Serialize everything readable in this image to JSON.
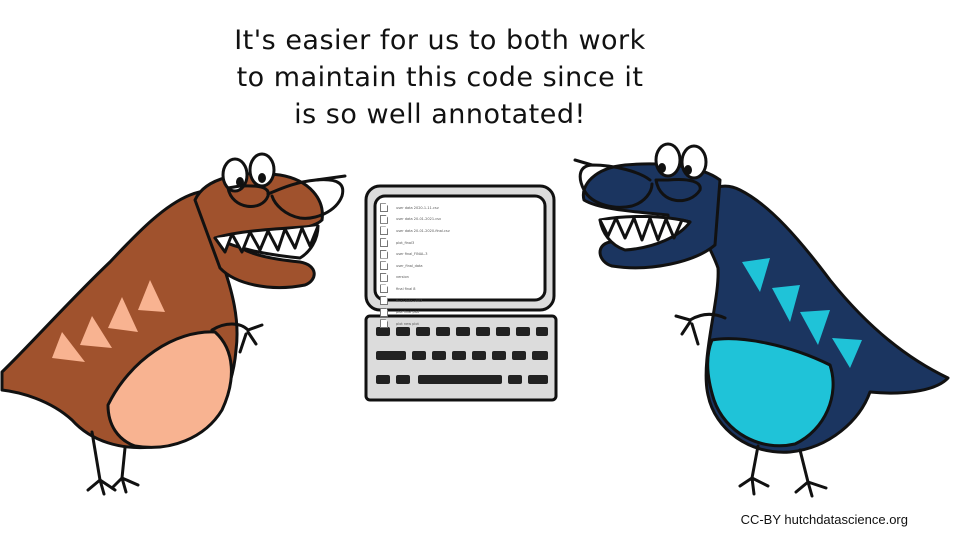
{
  "caption": {
    "line1": "It's easier for us to both work",
    "line2": "to maintain this code since it",
    "line3": "is so well annotated!"
  },
  "credit": "CC-BY hutchdatascience.org",
  "screen": {
    "files": [
      "user data 2020-1-11.csv",
      "user data 20-01-2021.csv",
      "user data 20-01-2020-final.csv",
      "plot_final3",
      "user final_FINAL-3",
      "user_final_data",
      "version",
      "final final 8",
      "final data v003",
      "plot final plot",
      "plot new plot"
    ]
  },
  "colors": {
    "brown_dino": "#a0522d",
    "brown_belly": "#f8b391",
    "navy_dino": "#1b3560",
    "cyan_belly": "#1fc3d8"
  }
}
